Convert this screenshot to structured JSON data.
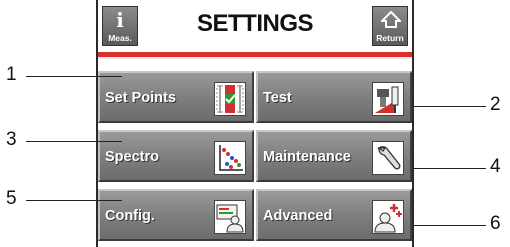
{
  "header": {
    "title": "SETTINGS",
    "meas_label": "Meas.",
    "return_label": "Return",
    "accent_color": "#d93030"
  },
  "buttons": [
    {
      "label": "Set Points",
      "icon": "set-points-icon"
    },
    {
      "label": "Test",
      "icon": "test-icon"
    },
    {
      "label": "Spectro",
      "icon": "spectro-icon"
    },
    {
      "label": "Maintenance",
      "icon": "wrench-icon"
    },
    {
      "label": "Config.",
      "icon": "config-icon"
    },
    {
      "label": "Advanced",
      "icon": "advanced-user-icon"
    }
  ],
  "callouts": [
    "1",
    "2",
    "3",
    "4",
    "5",
    "6"
  ]
}
